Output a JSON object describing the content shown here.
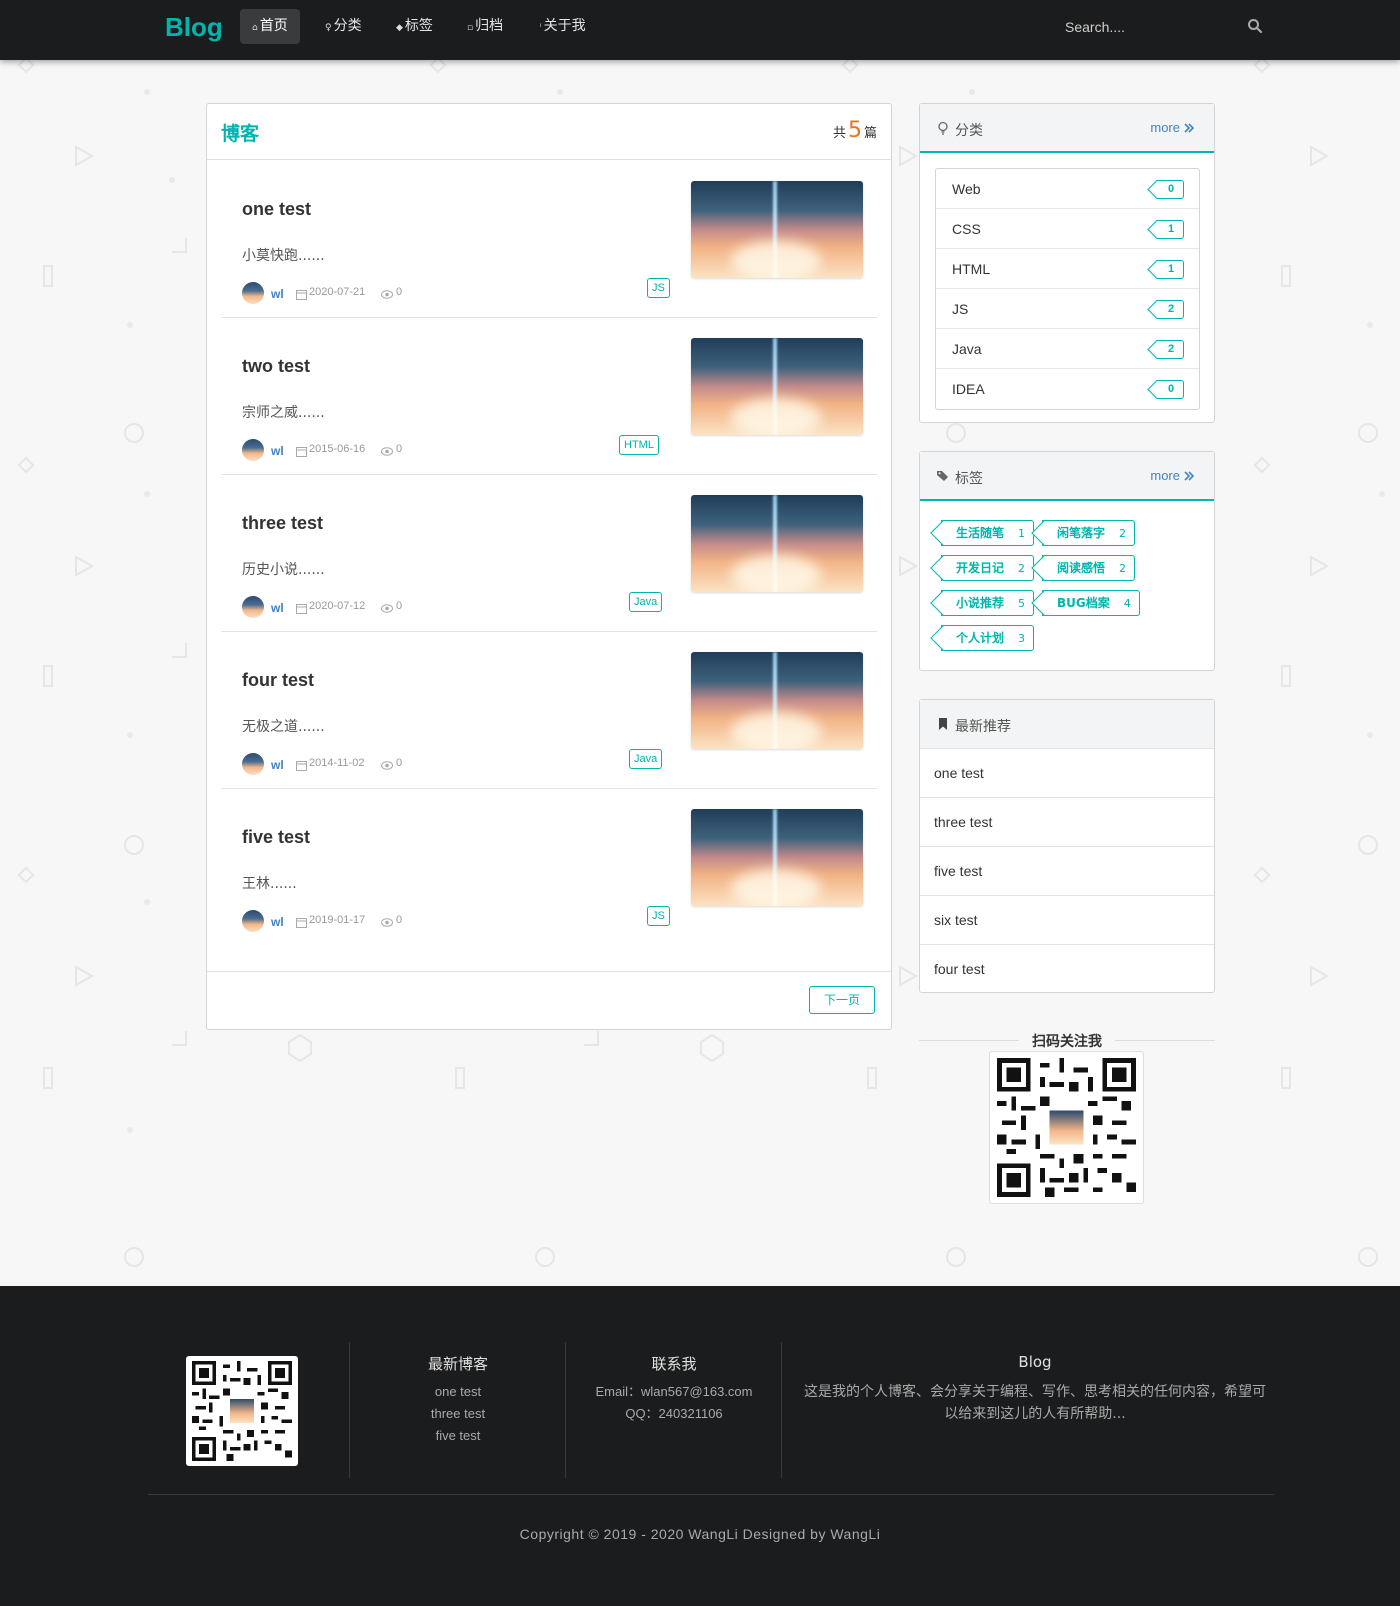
{
  "nav": {
    "brand": "Blog",
    "items": [
      {
        "label": "首页",
        "icon": "home-icon",
        "active": true
      },
      {
        "label": "分类",
        "icon": "idea-icon",
        "active": false
      },
      {
        "label": "标签",
        "icon": "tags-icon",
        "active": false
      },
      {
        "label": "归档",
        "icon": "clone-icon",
        "active": false
      },
      {
        "label": "关于我",
        "icon": "info-icon",
        "active": false
      }
    ],
    "search_placeholder": "Search....",
    "search_icon": "search-icon"
  },
  "blog_list": {
    "title": "博客",
    "count_prefix": "共",
    "count": "5",
    "count_suffix": "篇",
    "posts": [
      {
        "title": "one test",
        "desc": "小莫快跑......",
        "author": "wl",
        "date": "2020-07-21",
        "views": "0",
        "tag": "JS"
      },
      {
        "title": "two test",
        "desc": "宗师之威......",
        "author": "wl",
        "date": "2015-06-16",
        "views": "0",
        "tag": "HTML"
      },
      {
        "title": "three test",
        "desc": "历史小说......",
        "author": "wl",
        "date": "2020-07-12",
        "views": "0",
        "tag": "Java"
      },
      {
        "title": "four test",
        "desc": "无极之道......",
        "author": "wl",
        "date": "2014-11-02",
        "views": "0",
        "tag": "Java"
      },
      {
        "title": "five test",
        "desc": "王林......",
        "author": "wl",
        "date": "2019-01-17",
        "views": "0",
        "tag": "JS"
      }
    ],
    "next_page": "下一页"
  },
  "categories": {
    "title": "分类",
    "more": "more",
    "items": [
      {
        "name": "Web",
        "count": "0"
      },
      {
        "name": "CSS",
        "count": "1"
      },
      {
        "name": "HTML",
        "count": "1"
      },
      {
        "name": "JS",
        "count": "2"
      },
      {
        "name": "Java",
        "count": "2"
      },
      {
        "name": "IDEA",
        "count": "0"
      }
    ]
  },
  "tags": {
    "title": "标签",
    "more": "more",
    "items": [
      {
        "name": "生活随笔",
        "count": "1"
      },
      {
        "name": "闲笔落字",
        "count": "2"
      },
      {
        "name": "开发日记",
        "count": "2"
      },
      {
        "name": "阅读感悟",
        "count": "2"
      },
      {
        "name": "小说推荐",
        "count": "5"
      },
      {
        "name": "BUG档案",
        "count": "4"
      },
      {
        "name": "个人计划",
        "count": "3"
      }
    ]
  },
  "recommend": {
    "title": "最新推荐",
    "items": [
      "one test",
      "three test",
      "five test",
      "six test",
      "four test"
    ]
  },
  "qr_section": {
    "title": "扫码关注我"
  },
  "footer": {
    "latest_title": "最新博客",
    "latest_items": [
      "one test",
      "three test",
      "five test"
    ],
    "contact_title": "联系我",
    "email": "Email：wlan567@163.com",
    "qq": "QQ：240321106",
    "about_title": "Blog",
    "about_text": "这是我的个人博客、会分享关于编程、写作、思考相关的任何内容，希望可以给来到这儿的人有所帮助...",
    "copyright": "Copyright © 2019 - 2020 WangLi Designed by WangLi"
  },
  "colors": {
    "accent": "#00b5ad",
    "nav_bg": "#1b1c1d",
    "count": "#f2711c",
    "link": "#4183c4"
  }
}
